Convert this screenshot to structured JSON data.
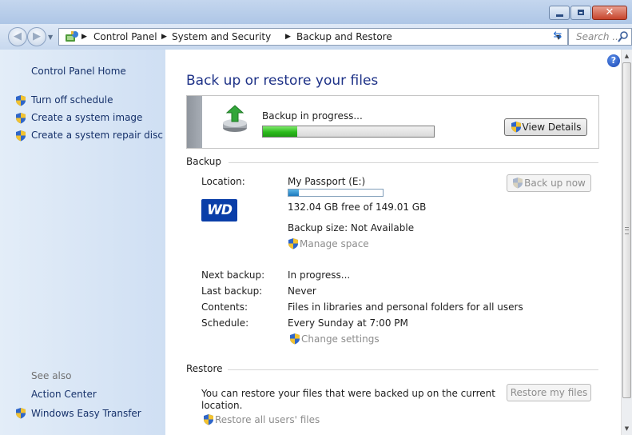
{
  "window": {
    "controls": {
      "close_glyph": "✕"
    }
  },
  "address": {
    "crumbs": [
      "Control Panel",
      "System and Security",
      "Backup and Restore"
    ],
    "search_placeholder": "Search ..."
  },
  "sidebar": {
    "home": "Control Panel Home",
    "tasks": [
      "Turn off schedule",
      "Create a system image",
      "Create a system repair disc"
    ],
    "see_also_label": "See also",
    "see_also": [
      "Action Center",
      "Windows Easy Transfer"
    ]
  },
  "main": {
    "title": "Back up or restore your files",
    "status": {
      "text": "Backup in progress...",
      "progress_percent": 20,
      "view_details_button": "View Details"
    },
    "backup": {
      "header": "Backup",
      "location_label": "Location:",
      "location_value": "My Passport (E:)",
      "drive_logo": "WD",
      "disk_used_percent": 11,
      "free_space": "132.04 GB free of 149.01 GB",
      "backup_size": "Backup size: Not Available",
      "manage_space_link": "Manage space",
      "back_up_now_button": "Back up now",
      "next_backup_label": "Next backup:",
      "next_backup_value": "In progress...",
      "last_backup_label": "Last backup:",
      "last_backup_value": "Never",
      "contents_label": "Contents:",
      "contents_value": "Files in libraries and personal folders for all users",
      "schedule_label": "Schedule:",
      "schedule_value": "Every Sunday at 7:00 PM",
      "change_settings_link": "Change settings"
    },
    "restore": {
      "header": "Restore",
      "line1": "You can restore your files that were backed up on the current",
      "line2": "location.",
      "restore_my_files_button": "Restore my files",
      "restore_all_users_link": "Restore all users' files"
    }
  },
  "icons": {
    "back": "back-arrow-icon",
    "forward": "forward-arrow-icon",
    "help": "help-icon",
    "uac": "uac-shield-icon"
  },
  "colors": {
    "link_blue": "#16316a",
    "title_blue": "#1e3287",
    "progress_green": "#2cba1d",
    "wd_blue": "#0a3ea8"
  }
}
